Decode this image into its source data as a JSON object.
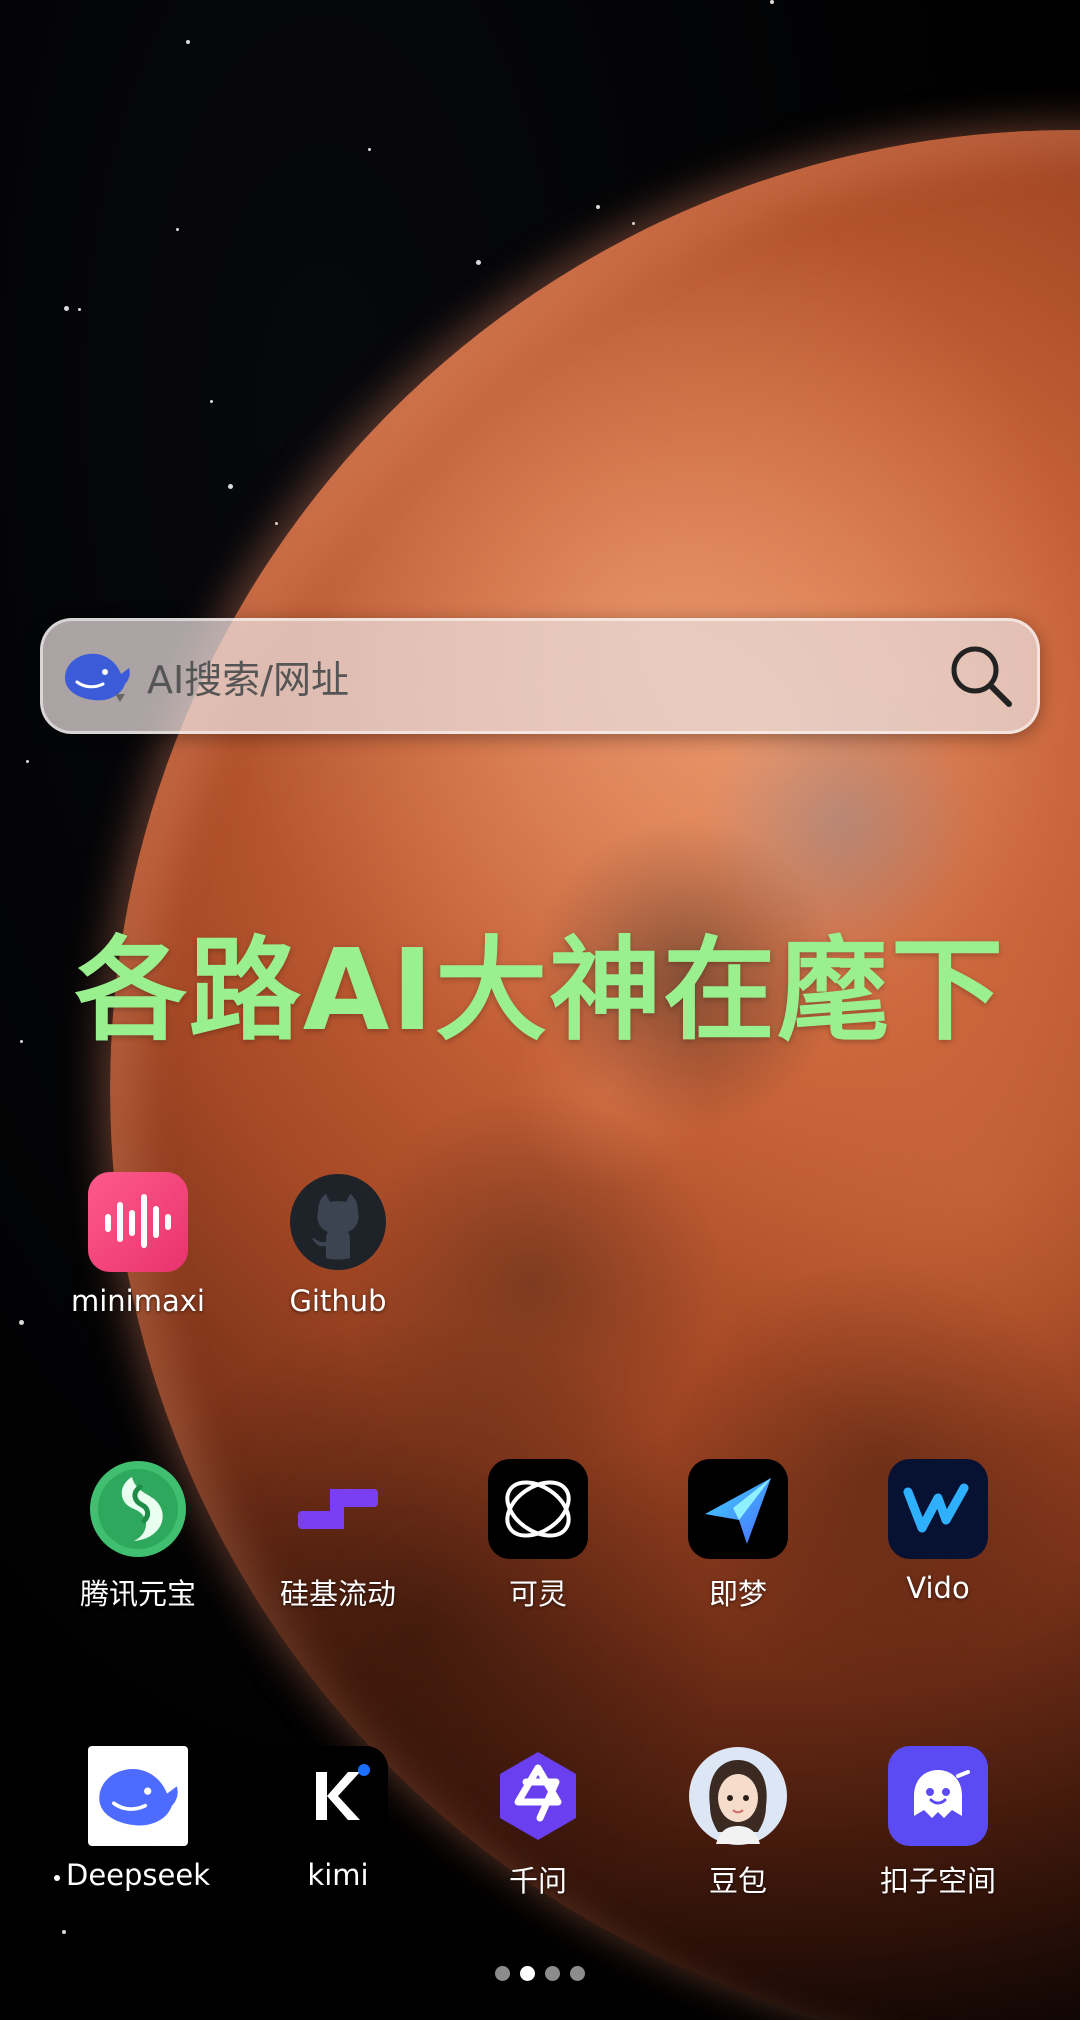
{
  "search": {
    "placeholder": "AI搜索/网址",
    "engine_icon": "deepseek-whale-icon",
    "button_icon": "search-icon"
  },
  "headline": {
    "text": "各路AI大神在麾下",
    "color": "#9af08e"
  },
  "apps": [
    {
      "id": "minimaxi",
      "label": "minimaxi",
      "icon": "minimax-waveform-icon",
      "color": "#f0427a"
    },
    {
      "id": "github",
      "label": "Github",
      "icon": "github-octocat-icon",
      "color": "#1e2329"
    },
    {
      "id": "yuanbao",
      "label": "腾讯元宝",
      "icon": "yuanbao-icon",
      "color": "#3fbf6f"
    },
    {
      "id": "siliconflow",
      "label": "硅基流动",
      "icon": "siliconflow-icon",
      "color": "#7b3ff2"
    },
    {
      "id": "kling",
      "label": "可灵",
      "icon": "kling-icon",
      "color": "#000000"
    },
    {
      "id": "jimeng",
      "label": "即梦",
      "icon": "jimeng-icon",
      "color": "#000000"
    },
    {
      "id": "vido",
      "label": "Vido",
      "icon": "vido-icon",
      "color": "#071233"
    },
    {
      "id": "deepseek",
      "label": "Deepseek",
      "icon": "deepseek-whale-icon",
      "color": "#ffffff"
    },
    {
      "id": "kimi",
      "label": "kimi",
      "icon": "kimi-icon",
      "color": "#000000"
    },
    {
      "id": "qianwen",
      "label": "千问",
      "icon": "qianwen-icon",
      "color": "#6a3ff0"
    },
    {
      "id": "doubao",
      "label": "豆包",
      "icon": "doubao-avatar-icon",
      "color": "#dde6f5"
    },
    {
      "id": "kouzi",
      "label": "扣子空间",
      "icon": "kouzi-ghost-icon",
      "color": "#5b4bf5"
    }
  ],
  "pager": {
    "count": 4,
    "active": 2
  }
}
